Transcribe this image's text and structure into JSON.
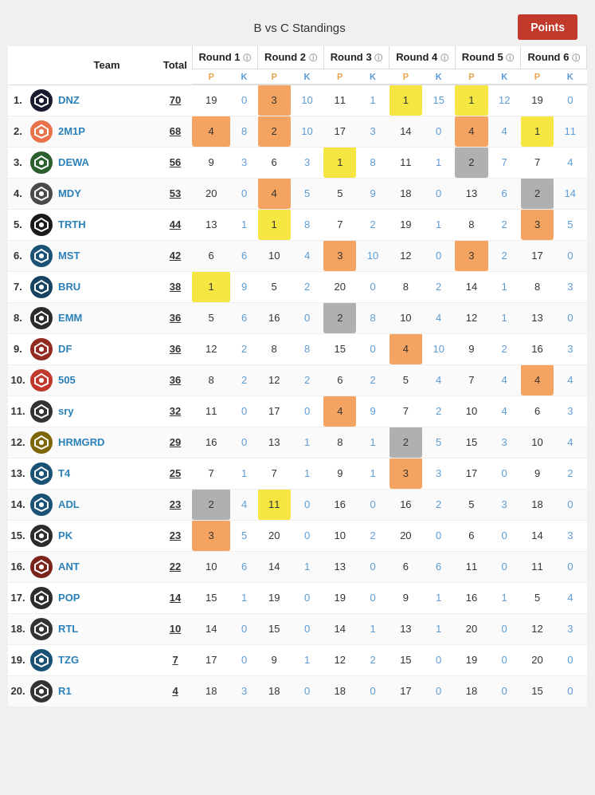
{
  "header": {
    "title": "B vs C Standings",
    "points_btn": "Points"
  },
  "columns": {
    "team": "Team",
    "total": "Total",
    "rounds": [
      "Round 1",
      "Round 2",
      "Round 3",
      "Round 4",
      "Round 5",
      "Round 6"
    ],
    "pk": [
      "P",
      "K",
      "P",
      "K",
      "P",
      "K",
      "P",
      "K",
      "P",
      "K",
      "P",
      "K"
    ]
  },
  "rows": [
    {
      "rank": "1.",
      "name": "DNZ",
      "total": "70",
      "color": "#e8734a",
      "rounds": [
        [
          19,
          0
        ],
        [
          3,
          10
        ],
        [
          11,
          1
        ],
        [
          1,
          15
        ],
        [
          1,
          12
        ],
        [
          19,
          0
        ]
      ],
      "highlights": {
        "r2p": "orange",
        "r4p": "yellow",
        "r5p": "yellow"
      }
    },
    {
      "rank": "2.",
      "name": "2M1P",
      "total": "68",
      "color": "#e8734a",
      "rounds": [
        [
          4,
          8
        ],
        [
          2,
          10
        ],
        [
          17,
          3
        ],
        [
          14,
          0
        ],
        [
          4,
          4
        ],
        [
          1,
          11
        ]
      ],
      "highlights": {
        "r1p": "orange",
        "r2p": "orange",
        "r5p": "orange",
        "r6p": "yellow"
      }
    },
    {
      "rank": "3.",
      "name": "DEWA",
      "total": "56",
      "color": "#8b4513",
      "rounds": [
        [
          9,
          3
        ],
        [
          6,
          3
        ],
        [
          1,
          8
        ],
        [
          11,
          1
        ],
        [
          2,
          7
        ],
        [
          7,
          4
        ]
      ],
      "highlights": {
        "r3p": "yellow",
        "r5p": "gray"
      }
    },
    {
      "rank": "4.",
      "name": "MDY",
      "total": "53",
      "color": "#666",
      "rounds": [
        [
          20,
          0
        ],
        [
          4,
          5
        ],
        [
          5,
          9
        ],
        [
          18,
          0
        ],
        [
          13,
          6
        ],
        [
          2,
          14
        ]
      ],
      "highlights": {
        "r2p": "orange",
        "r6p": "gray"
      }
    },
    {
      "rank": "5.",
      "name": "TRTH",
      "total": "44",
      "color": "#333",
      "rounds": [
        [
          13,
          1
        ],
        [
          1,
          8
        ],
        [
          7,
          2
        ],
        [
          19,
          1
        ],
        [
          8,
          2
        ],
        [
          3,
          5
        ]
      ],
      "highlights": {
        "r2p": "yellow",
        "r6p": "orange"
      }
    },
    {
      "rank": "6.",
      "name": "MST",
      "total": "42",
      "color": "#2980b9",
      "rounds": [
        [
          6,
          6
        ],
        [
          10,
          4
        ],
        [
          3,
          10
        ],
        [
          12,
          0
        ],
        [
          3,
          2
        ],
        [
          17,
          0
        ]
      ],
      "highlights": {
        "r3p": "orange",
        "r5p": "orange"
      }
    },
    {
      "rank": "7.",
      "name": "BRU",
      "total": "38",
      "color": "#2980b9",
      "rounds": [
        [
          1,
          9
        ],
        [
          5,
          2
        ],
        [
          20,
          0
        ],
        [
          8,
          2
        ],
        [
          14,
          1
        ],
        [
          8,
          3
        ]
      ],
      "highlights": {
        "r1p": "yellow"
      }
    },
    {
      "rank": "8.",
      "name": "EMM",
      "total": "36",
      "color": "#333",
      "rounds": [
        [
          5,
          6
        ],
        [
          16,
          0
        ],
        [
          2,
          8
        ],
        [
          10,
          4
        ],
        [
          12,
          1
        ],
        [
          13,
          0
        ]
      ],
      "highlights": {
        "r3p": "gray"
      }
    },
    {
      "rank": "9.",
      "name": "DF",
      "total": "36",
      "color": "#c0392b",
      "rounds": [
        [
          12,
          2
        ],
        [
          8,
          8
        ],
        [
          15,
          0
        ],
        [
          4,
          10
        ],
        [
          9,
          2
        ],
        [
          16,
          3
        ]
      ],
      "highlights": {
        "r4p": "orange"
      }
    },
    {
      "rank": "10.",
      "name": "505",
      "total": "36",
      "color": "#c0392b",
      "rounds": [
        [
          8,
          2
        ],
        [
          12,
          2
        ],
        [
          6,
          2
        ],
        [
          5,
          4
        ],
        [
          7,
          4
        ],
        [
          4,
          4
        ]
      ],
      "highlights": {
        "r6p": "orange"
      }
    },
    {
      "rank": "11.",
      "name": "sry",
      "total": "32",
      "color": "#333",
      "rounds": [
        [
          11,
          0
        ],
        [
          17,
          0
        ],
        [
          4,
          9
        ],
        [
          7,
          2
        ],
        [
          10,
          4
        ],
        [
          6,
          3
        ]
      ],
      "highlights": {
        "r3p": "orange"
      }
    },
    {
      "rank": "12.",
      "name": "HRMGRD",
      "total": "29",
      "color": "#8b6914",
      "rounds": [
        [
          16,
          0
        ],
        [
          13,
          1
        ],
        [
          8,
          1
        ],
        [
          2,
          5
        ],
        [
          15,
          3
        ],
        [
          10,
          4
        ]
      ],
      "highlights": {
        "r4p": "gray"
      }
    },
    {
      "rank": "13.",
      "name": "T4",
      "total": "25",
      "color": "#2980b9",
      "rounds": [
        [
          7,
          1
        ],
        [
          7,
          1
        ],
        [
          9,
          1
        ],
        [
          3,
          3
        ],
        [
          17,
          0
        ],
        [
          9,
          2
        ]
      ],
      "highlights": {
        "r4p": "orange"
      }
    },
    {
      "rank": "14.",
      "name": "ADL",
      "total": "23",
      "color": "#2980b9",
      "rounds": [
        [
          2,
          4
        ],
        [
          11,
          0
        ],
        [
          16,
          0
        ],
        [
          16,
          2
        ],
        [
          5,
          3
        ],
        [
          18,
          0
        ]
      ],
      "highlights": {
        "r1p": "gray",
        "r2p": "yellow"
      }
    },
    {
      "rank": "15.",
      "name": "PK",
      "total": "23",
      "color": "#333",
      "rounds": [
        [
          3,
          5
        ],
        [
          20,
          0
        ],
        [
          10,
          2
        ],
        [
          20,
          0
        ],
        [
          6,
          0
        ],
        [
          14,
          3
        ]
      ],
      "highlights": {
        "r1p": "orange"
      }
    },
    {
      "rank": "16.",
      "name": "ANT",
      "total": "22",
      "color": "#8b4513",
      "rounds": [
        [
          10,
          6
        ],
        [
          14,
          1
        ],
        [
          13,
          0
        ],
        [
          6,
          6
        ],
        [
          11,
          0
        ],
        [
          11,
          0
        ]
      ],
      "highlights": {}
    },
    {
      "rank": "17.",
      "name": "POP",
      "total": "14",
      "color": "#333",
      "rounds": [
        [
          15,
          1
        ],
        [
          19,
          0
        ],
        [
          19,
          0
        ],
        [
          9,
          1
        ],
        [
          16,
          1
        ],
        [
          5,
          4
        ]
      ],
      "highlights": {}
    },
    {
      "rank": "18.",
      "name": "RTL",
      "total": "10",
      "color": "#333",
      "rounds": [
        [
          14,
          0
        ],
        [
          15,
          0
        ],
        [
          14,
          1
        ],
        [
          13,
          1
        ],
        [
          20,
          0
        ],
        [
          12,
          3
        ]
      ],
      "highlights": {}
    },
    {
      "rank": "19.",
      "name": "TZG",
      "total": "7",
      "color": "#2980b9",
      "rounds": [
        [
          17,
          0
        ],
        [
          9,
          1
        ],
        [
          12,
          2
        ],
        [
          15,
          0
        ],
        [
          19,
          0
        ],
        [
          20,
          0
        ]
      ],
      "highlights": {}
    },
    {
      "rank": "20.",
      "name": "R1",
      "total": "4",
      "color": "#333",
      "rounds": [
        [
          18,
          3
        ],
        [
          18,
          0
        ],
        [
          18,
          0
        ],
        [
          17,
          0
        ],
        [
          18,
          0
        ],
        [
          15,
          0
        ]
      ],
      "highlights": {}
    }
  ]
}
